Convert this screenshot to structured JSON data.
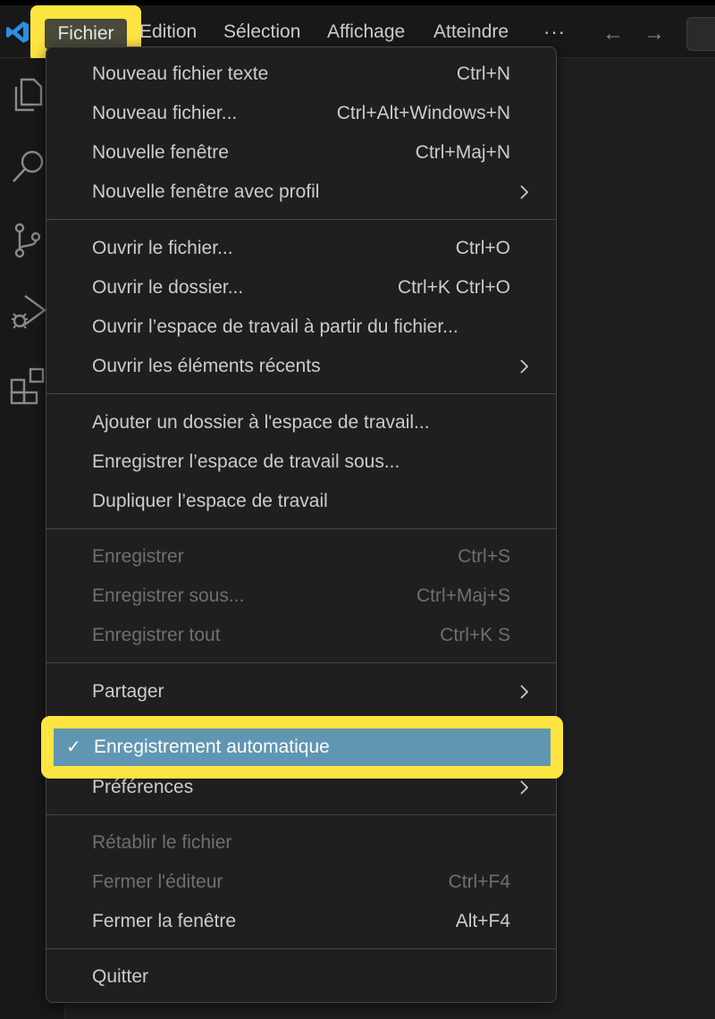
{
  "titlebar": {
    "menus": [
      "Fichier",
      "Edition",
      "Sélection",
      "Affichage",
      "Atteindre"
    ],
    "more": "···",
    "back_arrow": "←",
    "forward_arrow": "→"
  },
  "activity_icons": [
    "explorer-icon",
    "search-icon",
    "source-control-icon",
    "run-debug-icon",
    "extensions-icon"
  ],
  "file_menu": {
    "groups": [
      [
        {
          "label": "Nouveau fichier texte",
          "shortcut": "Ctrl+N"
        },
        {
          "label": "Nouveau fichier...",
          "shortcut": "Ctrl+Alt+Windows+N"
        },
        {
          "label": "Nouvelle fenêtre",
          "shortcut": "Ctrl+Maj+N"
        },
        {
          "label": "Nouvelle fenêtre avec profil",
          "submenu": true
        }
      ],
      [
        {
          "label": "Ouvrir le fichier...",
          "shortcut": "Ctrl+O"
        },
        {
          "label": "Ouvrir le dossier...",
          "shortcut": "Ctrl+K Ctrl+O"
        },
        {
          "label": "Ouvrir l’espace de travail à partir du fichier..."
        },
        {
          "label": "Ouvrir les éléments récents",
          "submenu": true
        }
      ],
      [
        {
          "label": "Ajouter un dossier à l'espace de travail..."
        },
        {
          "label": "Enregistrer l’espace de travail sous..."
        },
        {
          "label": "Dupliquer l’espace de travail"
        }
      ],
      [
        {
          "label": "Enregistrer",
          "shortcut": "Ctrl+S",
          "disabled": true
        },
        {
          "label": "Enregistrer sous...",
          "shortcut": "Ctrl+Maj+S",
          "disabled": true
        },
        {
          "label": "Enregistrer tout",
          "shortcut": "Ctrl+K S",
          "disabled": true
        }
      ],
      [
        {
          "label": "Partager",
          "submenu": true
        },
        {
          "label": "Enregistrement automatique",
          "checked": true,
          "check_mark": "✓",
          "highlighted": true
        },
        {
          "label": "Préférences",
          "submenu": true
        }
      ],
      [
        {
          "label": "Rétablir le fichier",
          "disabled": true
        },
        {
          "label": "Fermer l'éditeur",
          "shortcut": "Ctrl+F4",
          "disabled": true
        },
        {
          "label": "Fermer la fenêtre",
          "shortcut": "Alt+F4"
        }
      ],
      [
        {
          "label": "Quitter"
        }
      ]
    ]
  },
  "colors": {
    "highlight": "#ffe541",
    "selected_item": "#6196b3",
    "menu_bg": "#1f1f1f",
    "disabled_text": "#6f6f6f"
  }
}
